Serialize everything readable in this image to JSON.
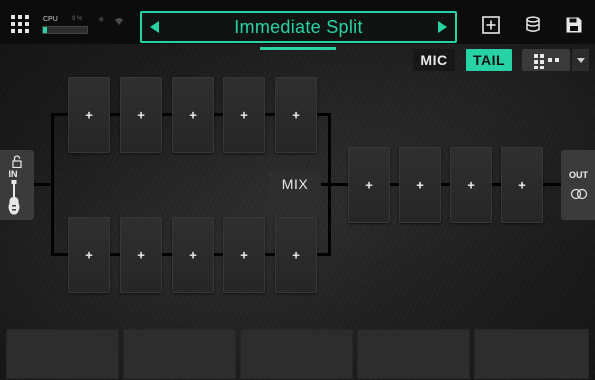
{
  "topbar": {
    "cpu_label": "CPU",
    "cpu_value": "9 %",
    "cpu_percent": 9,
    "preset_name": "Immediate Split"
  },
  "modes": {
    "mic_label": "MIC",
    "tail_label": "TAIL",
    "tail_active": true
  },
  "grid": {
    "top_row": [
      "+",
      "+",
      "+",
      "+",
      "+"
    ],
    "bottom_row": [
      "+",
      "+",
      "+",
      "+",
      "+"
    ],
    "post_row": [
      "+",
      "+",
      "+",
      "+"
    ],
    "mix_label": "MIX"
  },
  "io": {
    "in_label": "IN",
    "out_label": "OUT"
  },
  "bottom_panels": 5,
  "colors": {
    "accent": "#27d3a5",
    "background": "#1c1c1c",
    "slot": "#2a2a2a"
  },
  "icons": [
    "grid-menu-icon",
    "bluetooth-icon",
    "wifi-icon",
    "add-block-icon",
    "save-to-disk-icon",
    "save-icon",
    "lock-icon",
    "guitar-icon",
    "output-rings-icon"
  ]
}
